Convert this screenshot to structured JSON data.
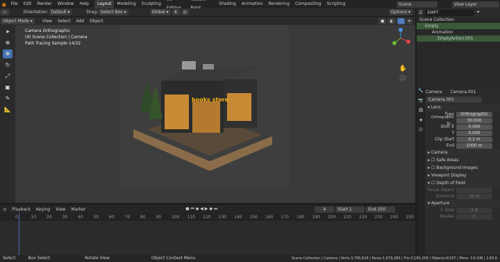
{
  "menubar": {
    "items": [
      "File",
      "Edit",
      "Render",
      "Window",
      "Help"
    ],
    "workspaces": [
      "Layout",
      "Modeling",
      "Sculpting",
      "UV Editing",
      "Texture Paint",
      "Shading",
      "Animation",
      "Rendering",
      "Compositing",
      "Scripting"
    ],
    "active_workspace": "Layout",
    "scene": "Scene",
    "view_layer": "View Layer"
  },
  "tool_header": {
    "orientation_label": "Orientation:",
    "orientation_value": "Default",
    "drag_label": "Drag:",
    "drag_value": "Select Box",
    "transform_space": "Global",
    "options": "Options"
  },
  "viewport_header": {
    "mode": "Object Mode",
    "menus": [
      "View",
      "Select",
      "Add",
      "Object"
    ]
  },
  "viewport_overlay": {
    "line1": "Camera Orthographic",
    "line2": "(4) Scene Collection | Camera",
    "line3": "Path Tracing Sample 14/32"
  },
  "render": {
    "sign": "books store"
  },
  "outliner": {
    "search": "EMPT",
    "rows": [
      "Scene Collection",
      "Empty",
      "Animation",
      "EmptyAction.001"
    ]
  },
  "properties": {
    "object": "Camera",
    "data": "Camera.001",
    "data_name": "Camera.001",
    "lens": {
      "title": "Lens",
      "type_label": "Type",
      "type_value": "Orthographic",
      "scale_label": "Orthographic Sc...",
      "scale_value": "30.000",
      "shift_x_label": "Shift X",
      "shift_x": "0.000",
      "shift_y_label": "Y",
      "shift_y": "0.000",
      "clip_start_label": "Clip Start",
      "clip_start": "0.1 m",
      "clip_end_label": "End",
      "clip_end": "1000 m"
    },
    "sections": [
      "Camera",
      "Safe Areas",
      "Background Images",
      "Viewport Display",
      "Depth of Field"
    ],
    "focus_object_label": "Focus Object",
    "distance_label": "Distance",
    "distance": "10 m",
    "aperture": "Aperture",
    "fstop_label": "F-Stop",
    "fstop": "2.8",
    "blades_label": "Blades",
    "blades": "0"
  },
  "timeline": {
    "menus": [
      "Playback",
      "Keying",
      "View",
      "Marker"
    ],
    "current_frame": "4",
    "start_label": "Start",
    "start": "1",
    "end_label": "End",
    "end": "250",
    "ticks": [
      "0",
      "10",
      "20",
      "30",
      "40",
      "50",
      "60",
      "70",
      "80",
      "90",
      "100",
      "110",
      "120",
      "130",
      "140",
      "150",
      "160",
      "170",
      "180",
      "190",
      "200",
      "210",
      "220",
      "230",
      "240",
      "250"
    ]
  },
  "status": {
    "select": "Select",
    "box_select": "Box Select",
    "rotate": "Rotate View",
    "context": "Object Context Menu",
    "stats": "Scene Collection | Camera | Verts:3,795,619 | Faces:1,679,280 | Tris:3,156,258 | Objects:0/197 | Mem: 3.6 GiB | 2.83.0"
  }
}
